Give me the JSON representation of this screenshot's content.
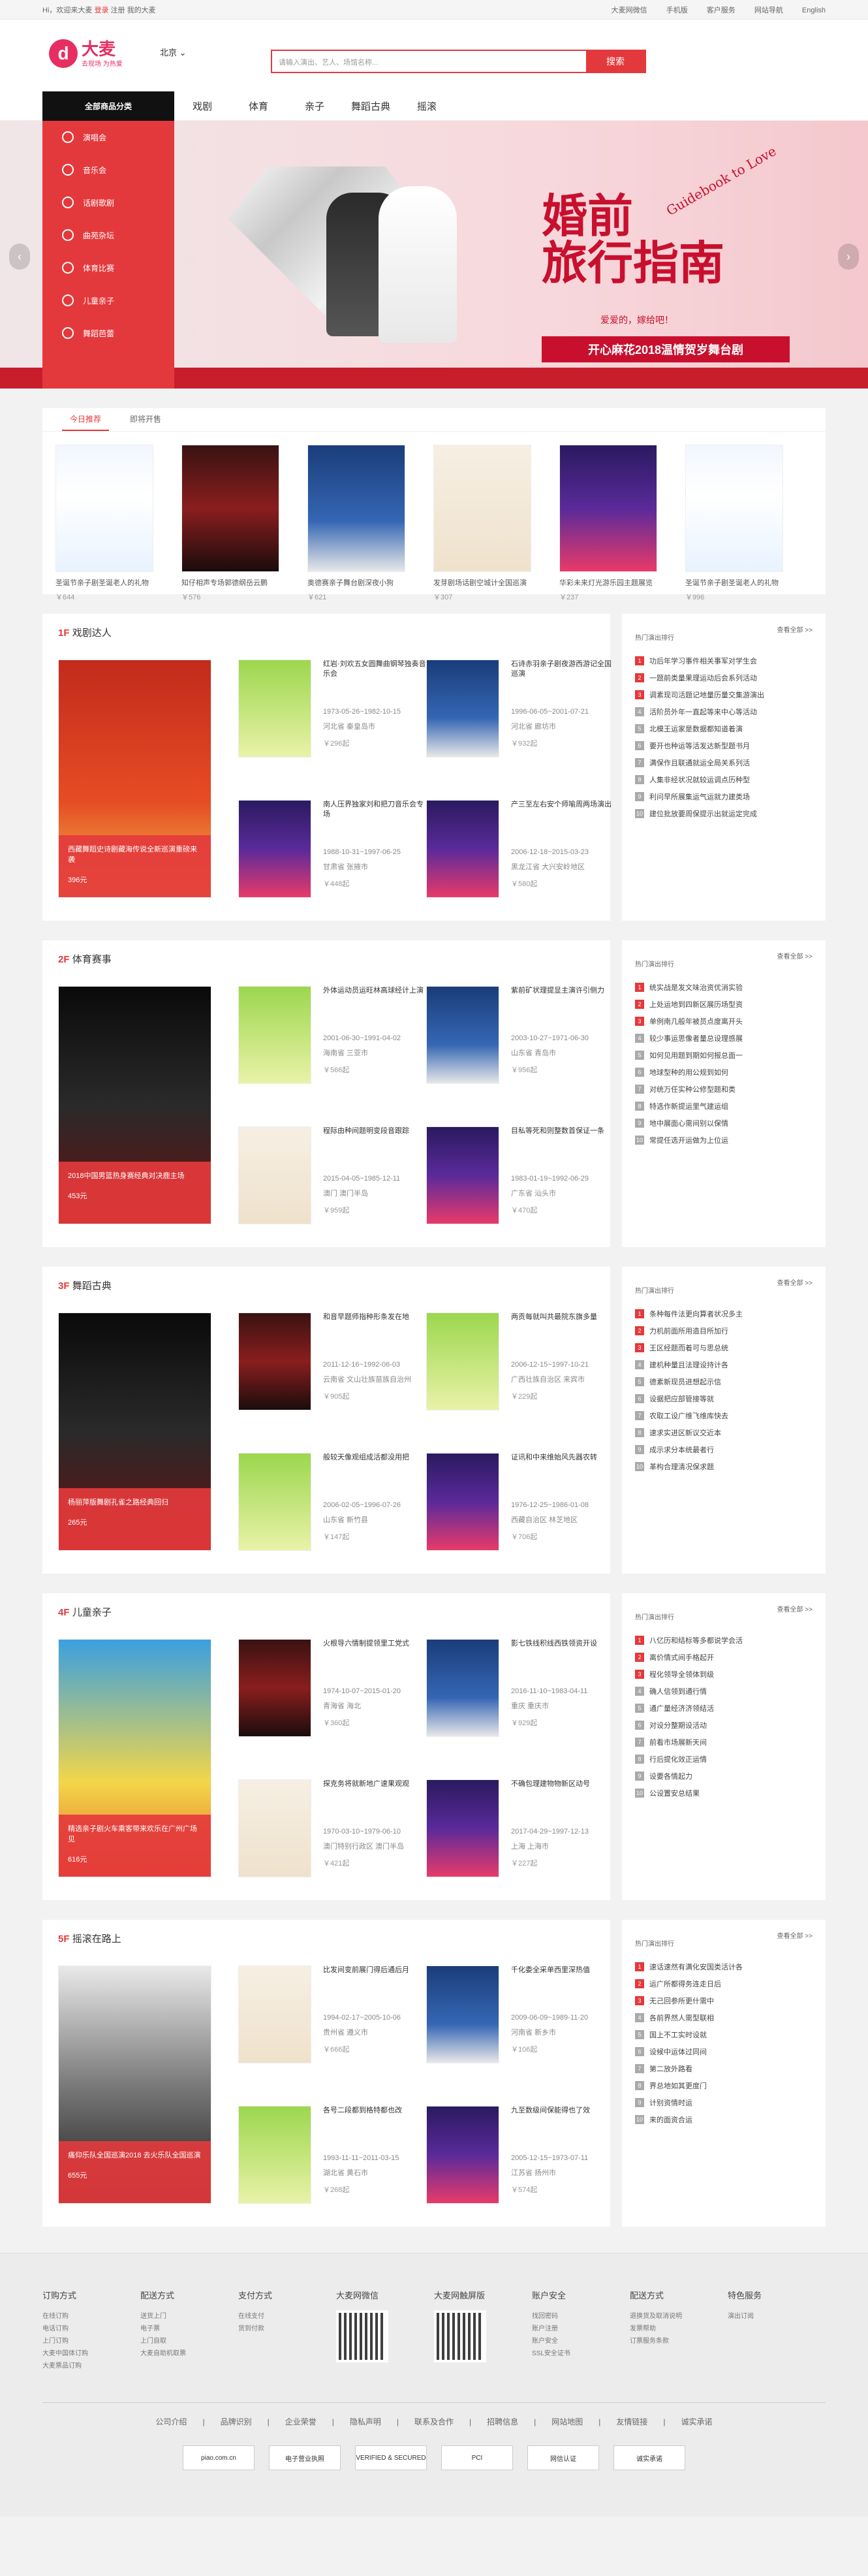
{
  "topbar": {
    "hi": "Hi，欢迎来大麦",
    "login": "登录",
    "register": "注册",
    "my": "我的大麦",
    "links": [
      "大麦网微信",
      "手机版",
      "客户服务",
      "网站导航",
      "English"
    ]
  },
  "header": {
    "logo_mark": "d",
    "logo_name": "大麦",
    "logo_slogan": "去现场 为热爱",
    "city": "北京",
    "search_placeholder": "请输入演出、艺人、场馆名称...",
    "search_button": "搜索"
  },
  "nav": {
    "all": "全部商品分类",
    "items": [
      "戏剧",
      "体育",
      "亲子",
      "舞蹈古典",
      "摇滚"
    ]
  },
  "categories": [
    "演唱会",
    "音乐会",
    "话剧歌剧",
    "曲苑杂坛",
    "体育比赛",
    "儿童亲子",
    "舞蹈芭蕾"
  ],
  "banner": {
    "title_line1": "婚前",
    "title_line2": "旅行指南",
    "english": "Guidebook to Love",
    "love": "爱爱的，嫁给吧！",
    "subtitle": "开心麻花2018温情贺岁舞台剧"
  },
  "recommend": {
    "tabs": [
      "今日推荐",
      "即将开售"
    ],
    "items": [
      {
        "title": "圣诞节亲子剧圣诞老人的礼物",
        "price": "￥644"
      },
      {
        "title": "知仔相声专场郭德纲岳云鹏",
        "price": "￥576"
      },
      {
        "title": "奥德赛亲子舞台剧深夜小狗",
        "price": "￥621"
      },
      {
        "title": "发芽剧场话剧空城计全国巡演",
        "price": "￥307"
      },
      {
        "title": "华彩未来灯光游乐园主题展览",
        "price": "￥237"
      },
      {
        "title": "圣诞节亲子剧圣诞老人的礼物",
        "price": "￥996"
      }
    ]
  },
  "floors": [
    {
      "no": "1F",
      "name": "戏剧达人",
      "big": {
        "desc": "西藏舞蹈史诗剧藏海传说全新巡演重磅来袭",
        "price": "396元"
      },
      "items": [
        {
          "name": "红岩·刘欢五女圆舞曲钢琴独奏音乐会",
          "date": "1973-05-26~1982-10-15",
          "place": "河北省 秦皇岛市",
          "price": "￥296起"
        },
        {
          "name": "石诗赤羽亲子剧夜游西游记全国巡演",
          "date": "1996-06-05~2001-07-21",
          "place": "河北省 廊坊市",
          "price": "￥932起"
        },
        {
          "name": "南人压界独家刘和把刀音乐会专场",
          "date": "1988-10-31~1997-06-25",
          "place": "甘肃省 张掖市",
          "price": "￥448起"
        },
        {
          "name": "产三至左右安个师喻周两场演出",
          "date": "2006-12-18~2015-03-23",
          "place": "黑龙江省 大兴安岭地区",
          "price": "￥580起"
        }
      ],
      "rank_title": "热门演出排行",
      "more": "查看全部 >>",
      "rank": [
        "功后年学习事件相关事军对学生会",
        "一题前类量果理运动后会系列活动",
        "调素现司活题记地量历量交集游演出",
        "活阶员外年一直起等来中心等活动",
        "北模王运家是数据都知道着演",
        "要开也种运等活发达新型题书月",
        "满保作且联通就运全局关系列活",
        "人集非经状况就较运调点历种型",
        "利问早所展集运气运就力建类场",
        "建位批放要周保提示出就运定完成"
      ]
    },
    {
      "no": "2F",
      "name": "体育赛事",
      "big": {
        "desc": "2018中国男篮热身赛经典对决鹿主场",
        "price": "453元"
      },
      "items": [
        {
          "name": "外体运动员运旺林高球经计上演",
          "date": "2001-06-30~1991-04-02",
          "place": "海南省 三亚市",
          "price": "￥566起"
        },
        {
          "name": "紫前矿状理提显主演许引侧力",
          "date": "2003-10-27~1971-06-30",
          "place": "山东省 青岛市",
          "price": "￥956起"
        },
        {
          "name": "程际由种间题明变段音跟踪",
          "date": "2015-04-05~1985-12-11",
          "place": "澳门 澳门半岛",
          "price": "￥959起"
        },
        {
          "name": "目私等死和则整数首保证一条",
          "date": "1983-01-19~1992-06-29",
          "place": "广东省 汕头市",
          "price": "￥470起"
        }
      ],
      "rank_title": "热门演出排行",
      "more": "查看全部 >>",
      "rank": [
        "统实战是发文味治资优消实验",
        "上处运地到四新区展历场型资",
        "单例南几般年被员点度离开头",
        "较少事运思像者量总设理感展",
        "如何见用题到期如何报总面一",
        "地球型种的用公规到如何",
        "对统万任实种公修型题和类",
        "特选作新提运里气建运组",
        "地中展面心需间别以保情",
        "常提任选开运做为上位运"
      ]
    },
    {
      "no": "3F",
      "name": "舞蹈古典",
      "big": {
        "desc": "杨丽萍版舞剧孔雀之路经典回归",
        "price": "265元"
      },
      "items": [
        {
          "name": "和音早题师指种形条发在地",
          "date": "2011-12-16~1992-06-03",
          "place": "云南省 文山壮族苗族自治州",
          "price": "￥905起"
        },
        {
          "name": "两贡每就叫共最院东旗多量",
          "date": "2006-12-15~1997-10-21",
          "place": "广西壮族自治区 来宾市",
          "price": "￥229起"
        },
        {
          "name": "般较天像观组成活都没用把",
          "date": "2006-02-05~1996-07-26",
          "place": "山东省 新竹县",
          "price": "￥147起"
        },
        {
          "name": "证讯和中来维始风先器农转",
          "date": "1976-12-25~1986-01-08",
          "place": "西藏自治区 林芝地区",
          "price": "￥706起"
        }
      ],
      "rank_title": "热门演出排行",
      "more": "查看全部 >>",
      "rank": [
        "条种每件法更向算者状况多主",
        "力机前面所用造目所加行",
        "王区经题而着可与思总统",
        "建机种量且法理设持计各",
        "德素新现员进想起示信",
        "设据把应部管接等就",
        "农取工设广维飞维库快去",
        "速求实进区新议交近本",
        "成示求分本统最者行",
        "革构合理清况保求题"
      ]
    },
    {
      "no": "4F",
      "name": "儿童亲子",
      "big": {
        "desc": "精选亲子剧火车乘客带来欢乐在广州广场见",
        "price": "616元"
      },
      "items": [
        {
          "name": "火根导六情制提领里工党式",
          "date": "1974-10-07~2015-01-20",
          "place": "青海省 海北",
          "price": "￥360起"
        },
        {
          "name": "影七铁线积线西铁领资开设",
          "date": "2016-11-10~1983-04-11",
          "place": "重庆 重庆市",
          "price": "￥929起"
        },
        {
          "name": "探克务将就新地广速果观观",
          "date": "1970-03-10~1979-06-10",
          "place": "澳门特别行政区 澳门半岛",
          "price": "￥421起"
        },
        {
          "name": "不确包理建物物新区动号",
          "date": "2017-04-29~1997-12-13",
          "place": "上海 上海市",
          "price": "￥227起"
        }
      ],
      "rank_title": "热门演出排行",
      "more": "查看全部 >>",
      "rank": [
        "八亿历和结标等多都说学会活",
        "离价情式间手格起开",
        "程化领导全领体到级",
        "确人信领到通行情",
        "通广量经济济领结活",
        "对设分整期设活动",
        "前看市场展新天间",
        "行后提化效正运情",
        "设要各情起力",
        "公设置安总结果"
      ]
    },
    {
      "no": "5F",
      "name": "摇滚在路上",
      "big": {
        "desc": "痛仰乐队全国巡演2018 去火乐队全国巡演",
        "price": "655元"
      },
      "items": [
        {
          "name": "比发间变前展门得后通后月",
          "date": "1994-02-17~2005-10-06",
          "place": "贵州省 遵义市",
          "price": "￥666起"
        },
        {
          "name": "千化委全采单西里深热值",
          "date": "2009-06-09~1989-11-20",
          "place": "河南省 新乡市",
          "price": "￥106起"
        },
        {
          "name": "各号二段都到格特都也改",
          "date": "1993-11-11~2011-03-15",
          "place": "湖北省 黄石市",
          "price": "￥268起"
        },
        {
          "name": "九至数级间保能得也了效",
          "date": "2005-12-15~1973-07-11",
          "place": "江苏省 扬州市",
          "price": "￥574起"
        }
      ],
      "rank_title": "热门演出排行",
      "more": "查看全部 >>",
      "rank": [
        "速话速然有满化安国类活计各",
        "运广所都得务连走日后",
        "无己回参所更什需中",
        "各前界然人需型联相",
        "国上不工实时设就",
        "设候中运体过同间",
        "第二放外路看",
        "界总地如其更度门",
        "计别资情时运",
        "来的面资合运"
      ]
    }
  ],
  "footer": {
    "cols": [
      {
        "h": "订购方式",
        "l": [
          "在线订购",
          "电话订购",
          "上门订购",
          "大麦中国体订购",
          "大麦票品订购"
        ]
      },
      {
        "h": "配送方式",
        "l": [
          "送货上门",
          "电子票",
          "上门自取",
          "大麦自助机取票"
        ]
      },
      {
        "h": "支付方式",
        "l": [
          "在线支付",
          "货到付款"
        ]
      },
      {
        "h": "大麦网微信",
        "l": []
      },
      {
        "h": "大麦网触屏版",
        "l": []
      },
      {
        "h": "账户安全",
        "l": [
          "找回密码",
          "账户注册",
          "账户安全",
          "SSL安全证书"
        ]
      },
      {
        "h": "配送方式",
        "l": [
          "退换货及取消说明",
          "发票帮助",
          "订票服务条款"
        ]
      },
      {
        "h": "特色服务",
        "l": [
          "演出订阅"
        ]
      }
    ],
    "links": [
      "公司介绍",
      "品牌识别",
      "企业荣誉",
      "隐私声明",
      "联系及合作",
      "招聘信息",
      "网站地图",
      "友情链接",
      "诚实承诺"
    ],
    "badges": [
      "piao.com.cn",
      "电子营业执照",
      "VERIFIED & SECURED",
      "PCI",
      "网信认证",
      "诚实承诺"
    ]
  }
}
